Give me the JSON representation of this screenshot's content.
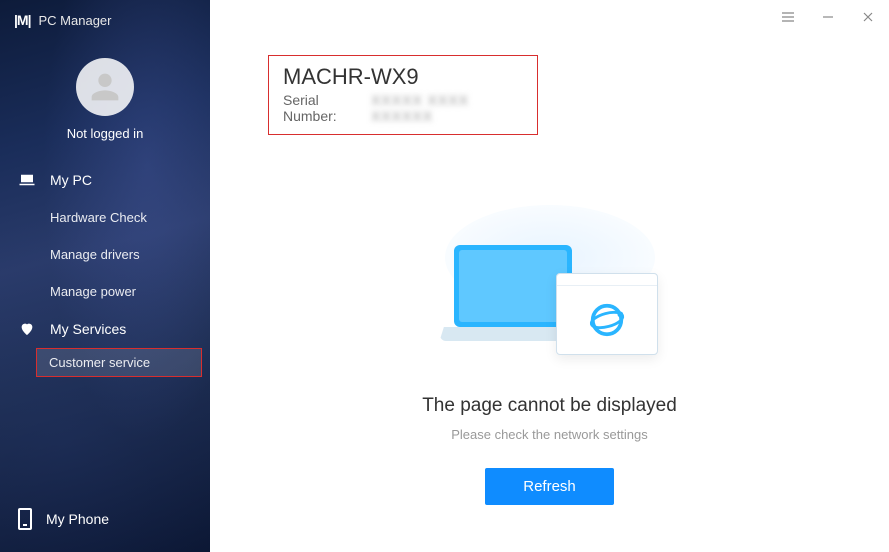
{
  "app": {
    "name": "PC Manager"
  },
  "user": {
    "login_status": "Not logged in"
  },
  "sidebar": {
    "categories": [
      {
        "label": "My PC",
        "icon": "laptop-icon",
        "items": [
          {
            "label": "Hardware Check"
          },
          {
            "label": "Manage drivers"
          },
          {
            "label": "Manage power"
          }
        ]
      },
      {
        "label": "My Services",
        "icon": "heart-icon",
        "items": [
          {
            "label": "Customer service",
            "selected": true,
            "highlighted": true
          }
        ]
      }
    ],
    "bottom": {
      "label": "My Phone",
      "icon": "phone-icon"
    }
  },
  "device": {
    "model": "MACHR-WX9",
    "serial_label": "Serial Number:",
    "serial_value": "XXXXX XXXX XXXXXX"
  },
  "error": {
    "title": "The page cannot be displayed",
    "subtitle": "Please check the network settings",
    "refresh_label": "Refresh"
  }
}
